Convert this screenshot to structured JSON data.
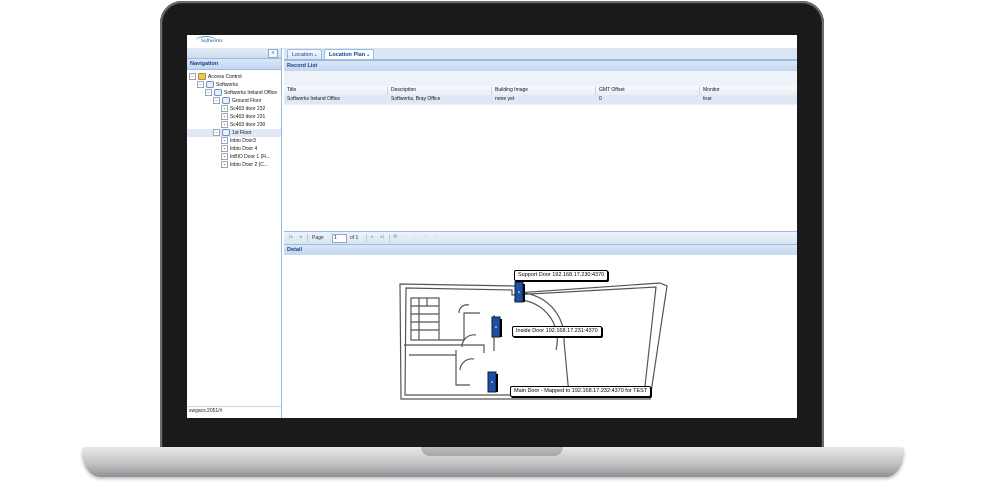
{
  "app": {
    "logo": "Softworks"
  },
  "nav": {
    "collapse": "«",
    "header": "Navigation",
    "tree": [
      {
        "label": "Access Control",
        "toggle": "−",
        "icon": "folder-icon"
      },
      {
        "label": "Softworks",
        "toggle": "−",
        "icon": "node-icon"
      },
      {
        "label": "Softworks Ireland Office",
        "toggle": "−",
        "icon": "node-icon"
      },
      {
        "label": "Ground Floor",
        "toggle": "−",
        "icon": "floor-icon"
      },
      {
        "label": "Sc403 door 232",
        "toggle": "+",
        "icon": "door-icon"
      },
      {
        "label": "Sc403 door 231",
        "toggle": "+",
        "icon": "door-icon"
      },
      {
        "label": "Sc403 door 230",
        "toggle": "+",
        "icon": "door-icon"
      },
      {
        "label": "1st Floor",
        "toggle": "−",
        "icon": "floor-icon"
      },
      {
        "label": "Inbio Door3",
        "toggle": "+",
        "icon": "door-icon"
      },
      {
        "label": "Inbio Door 4",
        "toggle": "+",
        "icon": "door-icon"
      },
      {
        "label": "InBIO Door 1 (Fi...",
        "toggle": "+",
        "icon": "door-icon"
      },
      {
        "label": "Inbio Door 2 (C...",
        "toggle": "+",
        "icon": "door-icon"
      }
    ],
    "status": "swgacs:2051/#"
  },
  "tabs": [
    {
      "label": "Location",
      "close": "▴"
    },
    {
      "label": "Location Plan",
      "close": "▴"
    }
  ],
  "record_list": {
    "header": "Record List",
    "columns": [
      "Title",
      "Description",
      "Building Image",
      "GMT Offset",
      "Monitor"
    ],
    "rows": [
      [
        "Softworks Ireland Office",
        "Softworks, Bray Office",
        "none yet",
        "0",
        "true"
      ]
    ]
  },
  "pager": {
    "first": "|◂",
    "prev": "◂",
    "page_label": "Page",
    "page_value": "1",
    "of_label": "of 1",
    "next": "▸",
    "last": "▸|",
    "refresh": "⟳"
  },
  "detail": {
    "header": "Detail",
    "doors": [
      {
        "label": "Support Door 192.168.17.230:4370"
      },
      {
        "label": "Inside Door 192.168.17.231:4370"
      },
      {
        "label": "Main Door - Mapped to 192.168.17.232:4370 for TEST"
      }
    ]
  }
}
